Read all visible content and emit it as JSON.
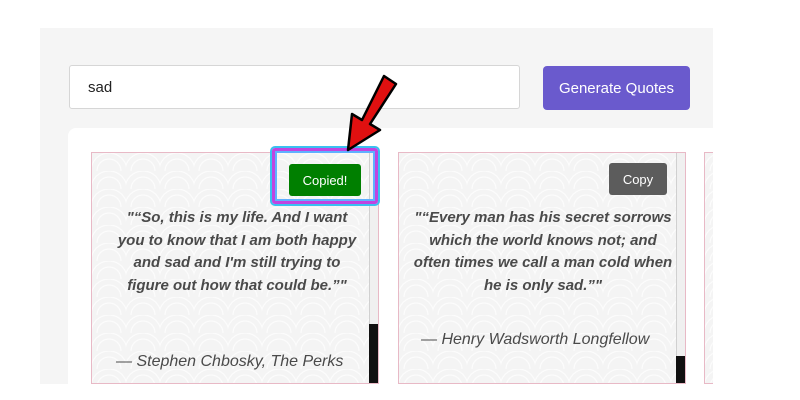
{
  "search": {
    "value": "sad",
    "placeholder": ""
  },
  "generate_button": {
    "label": "Generate Quotes"
  },
  "quotes": [
    {
      "text": "\"“So, this is my life. And I want you to know that I am both happy and sad and I'm still trying to figure out how that could be.”\"",
      "author": "— Stephen Chbosky, The Perks",
      "button_label": "Copied!",
      "button_state": "copied"
    },
    {
      "text": "\"“Every man has his secret sorrows which the world knows not; and often times we call a man cold when he is only sad.”\"",
      "author": "— Henry Wadsworth Longfellow",
      "button_label": "Copy",
      "button_state": "default"
    }
  ],
  "colors": {
    "accent": "#6a5acd",
    "copied": "#007f00",
    "copy": "#5c5c5c",
    "card_border": "#e8b9c6",
    "annotation_arrow": "#e01010",
    "annotation_highlight": "#c044e0"
  },
  "icons": {
    "annotation": "red-arrow-icon"
  }
}
